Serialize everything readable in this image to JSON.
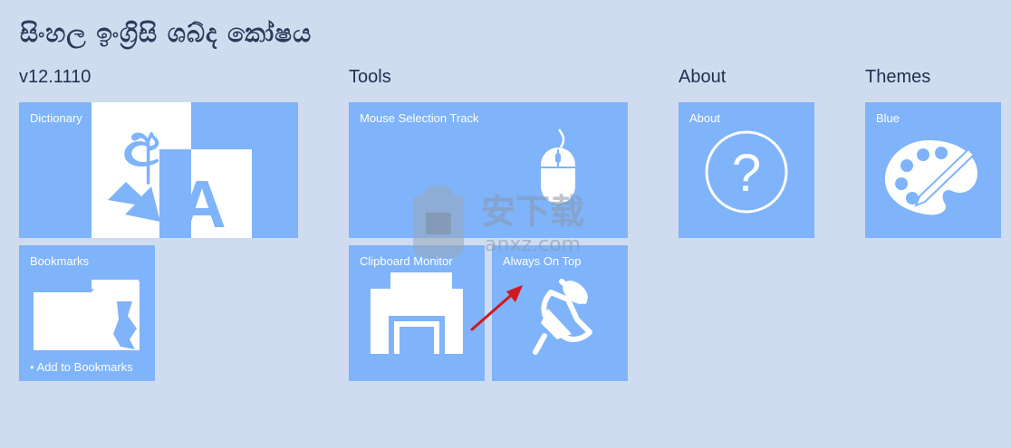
{
  "app": {
    "title": "සිංහල ඉංග්‍රිසි ශබ්ද කෝෂය"
  },
  "groups": {
    "version": "v12.1110",
    "tools": "Tools",
    "about": "About",
    "themes": "Themes"
  },
  "tiles": {
    "dictionary": {
      "label": "Dictionary",
      "glyph": "අ",
      "glyph2": "A"
    },
    "bookmarks": {
      "label": "Bookmarks",
      "sub": "•   Add to Bookmarks"
    },
    "mouse_track": {
      "label": "Mouse Selection Track"
    },
    "clipboard": {
      "label": "Clipboard Monitor"
    },
    "always_on_top": {
      "label": "Always On Top"
    },
    "about": {
      "label": "About",
      "glyph": "?"
    },
    "blue": {
      "label": "Blue"
    }
  },
  "watermark": {
    "text": "安下载",
    "sub": "anxz.com"
  },
  "colors": {
    "background": "#cfdcef",
    "tile": "#7fb3fa",
    "text": "#1f2f4f",
    "arrow": "#d0181e"
  }
}
